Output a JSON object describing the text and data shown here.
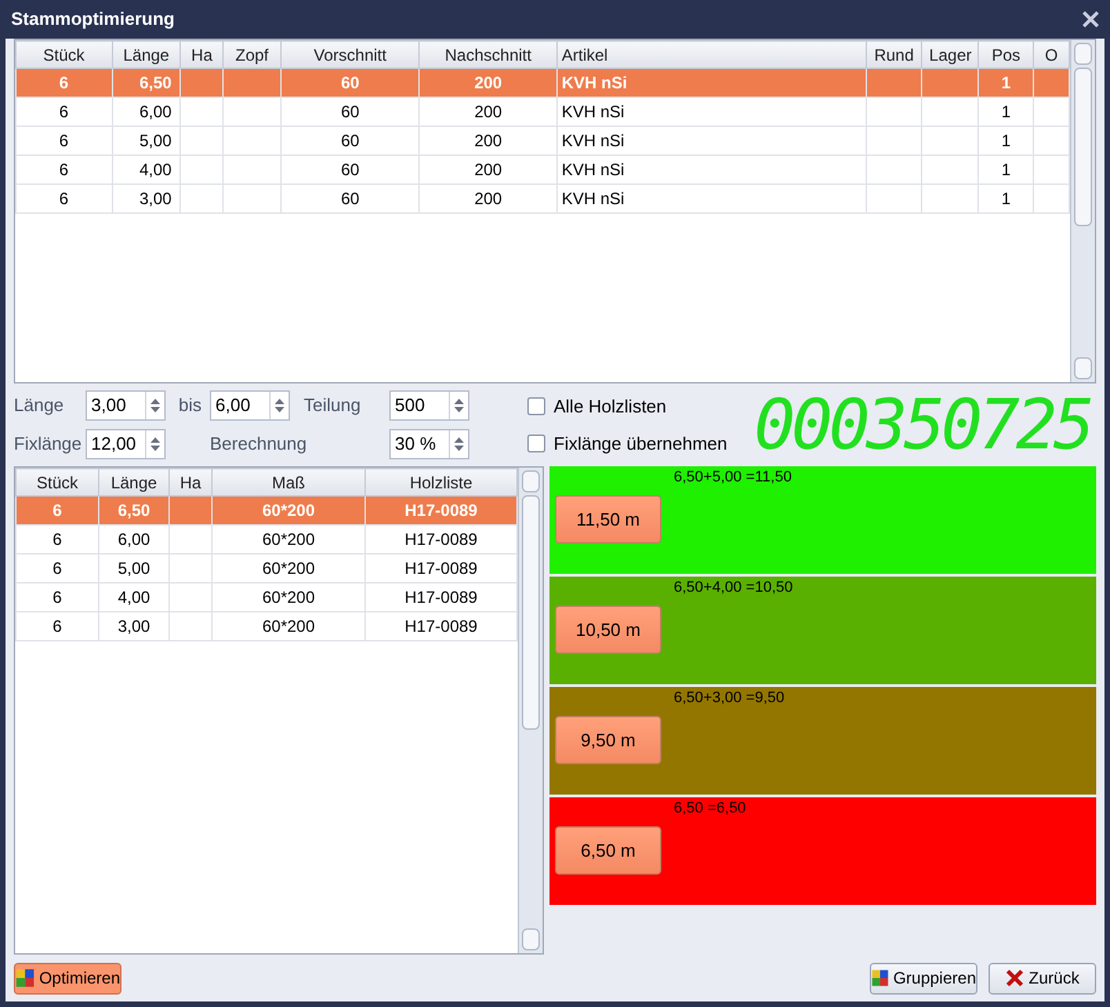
{
  "window": {
    "title": "Stammoptimierung"
  },
  "top_table": {
    "columns": [
      "Stück",
      "Länge",
      "Ha",
      "Zopf",
      "Vorschnitt",
      "Nachschnitt",
      "Artikel",
      "Rund",
      "Lager",
      "Pos",
      "O"
    ],
    "rows": [
      {
        "selected": true,
        "cells": [
          "6",
          "6,50",
          "",
          "",
          "60",
          "200",
          "KVH nSi",
          "",
          "",
          "1",
          ""
        ]
      },
      {
        "selected": false,
        "cells": [
          "6",
          "6,00",
          "",
          "",
          "60",
          "200",
          "KVH nSi",
          "",
          "",
          "1",
          ""
        ]
      },
      {
        "selected": false,
        "cells": [
          "6",
          "5,00",
          "",
          "",
          "60",
          "200",
          "KVH nSi",
          "",
          "",
          "1",
          ""
        ]
      },
      {
        "selected": false,
        "cells": [
          "6",
          "4,00",
          "",
          "",
          "60",
          "200",
          "KVH nSi",
          "",
          "",
          "1",
          ""
        ]
      },
      {
        "selected": false,
        "cells": [
          "6",
          "3,00",
          "",
          "",
          "60",
          "200",
          "KVH nSi",
          "",
          "",
          "1",
          ""
        ]
      }
    ]
  },
  "filters": {
    "laenge": {
      "label": "Länge",
      "value": "3,00"
    },
    "bis": {
      "label": "bis",
      "value": "6,00"
    },
    "teilung": {
      "label": "Teilung",
      "value": "500"
    },
    "fixlaenge": {
      "label": "Fixlänge",
      "value": "12,00"
    },
    "berechnung": {
      "label": "Berechnung",
      "value": "30 %"
    }
  },
  "checkboxes": [
    {
      "label": "Alle Holzlisten",
      "checked": false
    },
    {
      "label": "Fixlänge übernehmen",
      "checked": false
    }
  ],
  "counter": "000350725",
  "bottom_table": {
    "columns": [
      "Stück",
      "Länge",
      "Ha",
      "Maß",
      "Holzliste"
    ],
    "rows": [
      {
        "selected": true,
        "cells": [
          "6",
          "6,50",
          "",
          "60*200",
          "H17-0089"
        ]
      },
      {
        "selected": false,
        "cells": [
          "6",
          "6,00",
          "",
          "60*200",
          "H17-0089"
        ]
      },
      {
        "selected": false,
        "cells": [
          "6",
          "5,00",
          "",
          "60*200",
          "H17-0089"
        ]
      },
      {
        "selected": false,
        "cells": [
          "6",
          "4,00",
          "",
          "60*200",
          "H17-0089"
        ]
      },
      {
        "selected": false,
        "cells": [
          "6",
          "3,00",
          "",
          "60*200",
          "H17-0089"
        ]
      }
    ]
  },
  "results": [
    {
      "formula": "6,50+5,00 =11,50",
      "button": "11,50 m",
      "color": "#1ef000"
    },
    {
      "formula": "6,50+4,00 =10,50",
      "button": "10,50 m",
      "color": "#5ab000"
    },
    {
      "formula": "6,50+3,00 =9,50",
      "button": "9,50 m",
      "color": "#937600"
    },
    {
      "formula": "6,50 =6,50",
      "button": "6,50 m",
      "color": "#ff0000"
    }
  ],
  "buttons": [
    {
      "label": "Optimieren",
      "kind": "optimize"
    },
    {
      "label": "Gruppieren",
      "kind": "group"
    },
    {
      "label": "Zurück",
      "kind": "back"
    }
  ]
}
